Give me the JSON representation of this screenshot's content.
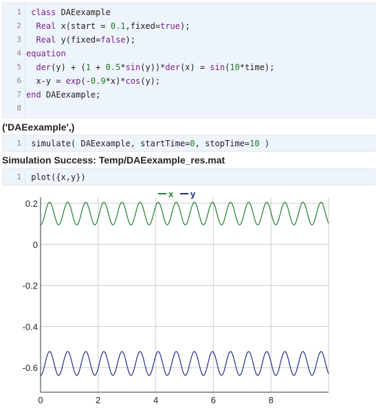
{
  "cell1": {
    "line_numbers": [
      "1",
      "2",
      "3",
      "4",
      "5",
      "6",
      "7",
      "8"
    ],
    "lines": [
      [
        {
          "t": " ",
          "c": ""
        },
        {
          "t": "class",
          "c": "kw"
        },
        {
          "t": " DAEexample",
          "c": ""
        }
      ],
      [
        {
          "t": "  ",
          "c": ""
        },
        {
          "t": "Real",
          "c": "kw"
        },
        {
          "t": " x(start = ",
          "c": ""
        },
        {
          "t": "0.1",
          "c": "num"
        },
        {
          "t": ",fixed=",
          "c": ""
        },
        {
          "t": "true",
          "c": "kw"
        },
        {
          "t": ");",
          "c": ""
        }
      ],
      [
        {
          "t": "  ",
          "c": ""
        },
        {
          "t": "Real",
          "c": "kw"
        },
        {
          "t": " y(fixed=",
          "c": ""
        },
        {
          "t": "false",
          "c": "kw"
        },
        {
          "t": ");",
          "c": ""
        }
      ],
      [
        {
          "t": "equation",
          "c": "kw"
        }
      ],
      [
        {
          "t": "  ",
          "c": ""
        },
        {
          "t": "der",
          "c": "fn"
        },
        {
          "t": "(y) + (",
          "c": ""
        },
        {
          "t": "1",
          "c": "num"
        },
        {
          "t": " + ",
          "c": ""
        },
        {
          "t": "0.5",
          "c": "num"
        },
        {
          "t": "*",
          "c": ""
        },
        {
          "t": "sin",
          "c": "fn"
        },
        {
          "t": "(y))*",
          "c": ""
        },
        {
          "t": "der",
          "c": "fn"
        },
        {
          "t": "(x) = ",
          "c": ""
        },
        {
          "t": "sin",
          "c": "fn"
        },
        {
          "t": "(",
          "c": ""
        },
        {
          "t": "10",
          "c": "num"
        },
        {
          "t": "*time);",
          "c": ""
        }
      ],
      [
        {
          "t": "  x-y = ",
          "c": ""
        },
        {
          "t": "exp",
          "c": "fn"
        },
        {
          "t": "(-",
          "c": ""
        },
        {
          "t": "0.9",
          "c": "num"
        },
        {
          "t": "*x)*",
          "c": ""
        },
        {
          "t": "cos",
          "c": "fn"
        },
        {
          "t": "(y);",
          "c": ""
        }
      ],
      [
        {
          "t": "end",
          "c": "kw"
        },
        {
          "t": " DAEexample;",
          "c": ""
        }
      ],
      []
    ]
  },
  "output1": "('DAEexample',)",
  "cell2": {
    "line_numbers": [
      "1"
    ],
    "lines": [
      [
        {
          "t": " simulate( DAEexample, startTime=",
          "c": ""
        },
        {
          "t": "0",
          "c": "num"
        },
        {
          "t": ", stopTime=",
          "c": ""
        },
        {
          "t": "10",
          "c": "num"
        },
        {
          "t": " )",
          "c": ""
        }
      ]
    ]
  },
  "output2": "Simulation Success: Temp/DAEexample_res.mat",
  "cell3": {
    "line_numbers": [
      "1"
    ],
    "lines": [
      [
        {
          "t": " plot({x,y})",
          "c": ""
        }
      ]
    ]
  },
  "colors": {
    "x": "#1f7a2e",
    "y": "#1f2a8a",
    "grid": "#cccccc"
  },
  "chart_data": {
    "type": "line",
    "title": "",
    "xlabel": "",
    "ylabel": "",
    "xlim": [
      0,
      10
    ],
    "ylim": [
      -0.72,
      0.23
    ],
    "xticks": [
      0,
      2,
      4,
      6,
      8
    ],
    "yticks": [
      0.2,
      0,
      -0.2,
      -0.4,
      -0.6
    ],
    "ytick_labels": [
      "0.2",
      "0",
      "-0.2",
      "-0.4",
      "-0.6"
    ],
    "grid": true,
    "legend": "top-center",
    "series": [
      {
        "name": "x",
        "description": "oscillation about 0.15, amplitude 0.055, period ~0.628",
        "mean": 0.15,
        "amplitude": 0.055,
        "period": 0.6283,
        "phase": 0.0
      },
      {
        "name": "y",
        "description": "oscillation about -0.58, amplitude 0.058, period ~0.628",
        "mean": -0.58,
        "amplitude": 0.058,
        "period": 0.6283,
        "phase": 0.0
      }
    ]
  }
}
